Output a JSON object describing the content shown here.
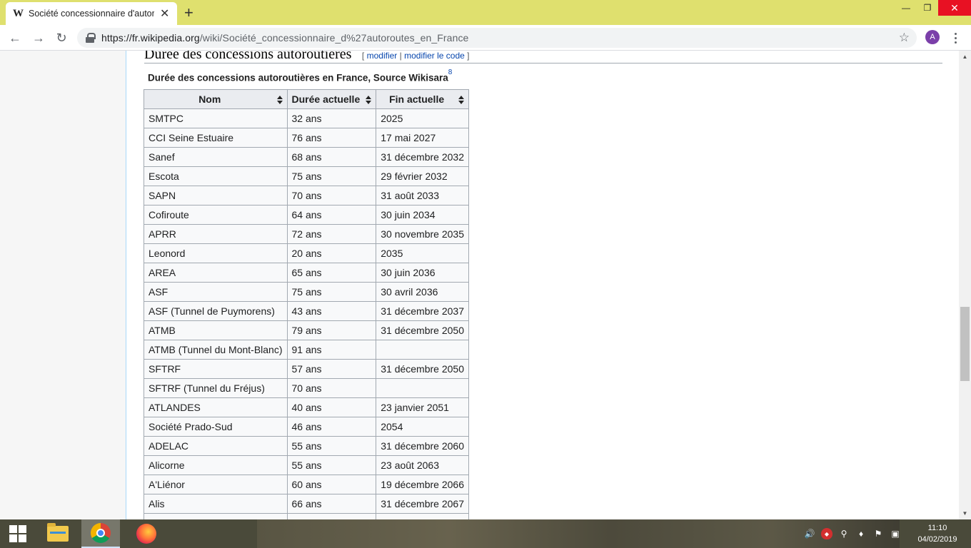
{
  "browser": {
    "tab_title": "Société concessionnaire d'autoro",
    "favicon": "W",
    "url_host": "https://fr.wikipedia.org",
    "url_path": "/wiki/Société_concessionnaire_d%27autoroutes_en_France",
    "profile_initial": "A"
  },
  "icons": {
    "back": "arrow-left-icon",
    "forward": "arrow-right-icon",
    "reload": "reload-icon",
    "lock": "lock-icon",
    "star": "star-icon",
    "menu": "kebab-menu-icon"
  },
  "article": {
    "heading": "Durée des concessions autoroutières",
    "edit_open": "[",
    "edit_label": "modifier",
    "edit_sep": "|",
    "edit_code_label": "modifier le code",
    "edit_close": "]",
    "caption": "Durée des concessions autoroutières en France, Source Wikisara",
    "caption_ref": "8",
    "table": {
      "headers": [
        "Nom",
        "Durée actuelle",
        "Fin actuelle"
      ],
      "rows": [
        [
          "SMTPC",
          "32 ans",
          "2025"
        ],
        [
          "CCI Seine Estuaire",
          "76 ans",
          "17 mai 2027"
        ],
        [
          "Sanef",
          "68 ans",
          "31 décembre 2032"
        ],
        [
          "Escota",
          "75 ans",
          "29 février 2032"
        ],
        [
          "SAPN",
          "70 ans",
          "31 août 2033"
        ],
        [
          "Cofiroute",
          "64 ans",
          "30 juin 2034"
        ],
        [
          "APRR",
          "72 ans",
          "30 novembre 2035"
        ],
        [
          "Leonord",
          "20 ans",
          "2035"
        ],
        [
          "AREA",
          "65 ans",
          "30 juin 2036"
        ],
        [
          "ASF",
          "75 ans",
          "30 avril 2036"
        ],
        [
          "ASF (Tunnel de Puymorens)",
          "43 ans",
          "31 décembre 2037"
        ],
        [
          "ATMB",
          "79 ans",
          "31 décembre 2050"
        ],
        [
          "ATMB (Tunnel du Mont-Blanc)",
          "91 ans",
          ""
        ],
        [
          "SFTRF",
          "57 ans",
          "31 décembre 2050"
        ],
        [
          "SFTRF (Tunnel du Fréjus)",
          "70 ans",
          ""
        ],
        [
          "ATLANDES",
          "40 ans",
          "23 janvier 2051"
        ],
        [
          "Société Prado-Sud",
          "46 ans",
          "2054"
        ],
        [
          "ADELAC",
          "55 ans",
          "31 décembre 2060"
        ],
        [
          "Alicorne",
          "55 ans",
          "23 août 2063"
        ],
        [
          "A'Liénor",
          "60 ans",
          "19 décembre 2066"
        ],
        [
          "Alis",
          "66 ans",
          "31 décembre 2067"
        ]
      ]
    }
  },
  "taskbar": {
    "time": "11:10",
    "date": "04/02/2019"
  },
  "colors": {
    "titlebar": "#dfe06e",
    "link": "#0645ad",
    "table_header": "#eaecf0",
    "table_border": "#a2a9b1"
  }
}
